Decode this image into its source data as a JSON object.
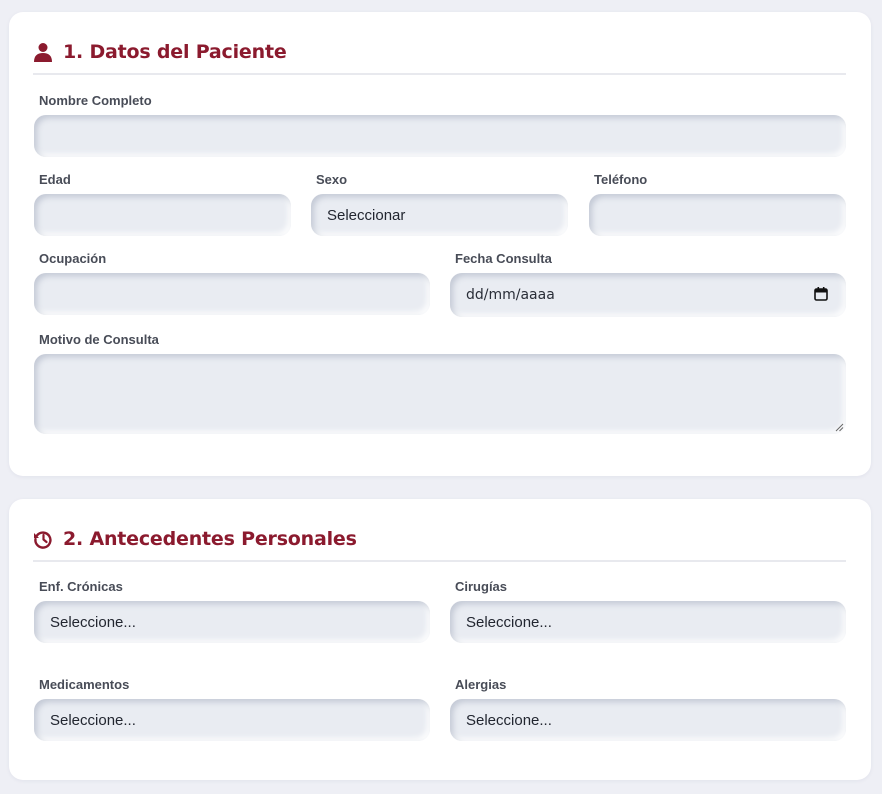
{
  "section1": {
    "title": "1. Datos del Paciente",
    "icon": "user-icon",
    "fields": {
      "nombre": {
        "label": "Nombre Completo",
        "value": ""
      },
      "edad": {
        "label": "Edad",
        "value": ""
      },
      "sexo": {
        "label": "Sexo",
        "value": "Seleccionar"
      },
      "telefono": {
        "label": "Teléfono",
        "value": ""
      },
      "ocupacion": {
        "label": "Ocupación",
        "value": ""
      },
      "fecha": {
        "label": "Fecha Consulta",
        "placeholder": "dd/mm/aaaa"
      },
      "motivo": {
        "label": "Motivo de Consulta",
        "value": ""
      }
    }
  },
  "section2": {
    "title": "2. Antecedentes Personales",
    "icon": "history-icon",
    "fields": {
      "cronicas": {
        "label": "Enf. Crónicas",
        "value": "Seleccione..."
      },
      "cirugias": {
        "label": "Cirugías",
        "value": "Seleccione..."
      },
      "medicamentos": {
        "label": "Medicamentos",
        "value": "Seleccione..."
      },
      "alergias": {
        "label": "Alergias",
        "value": "Seleccione..."
      }
    }
  },
  "colors": {
    "accent": "#8b1a2e",
    "page_background": "#eeeff5",
    "field_background": "#e9ecf2"
  }
}
